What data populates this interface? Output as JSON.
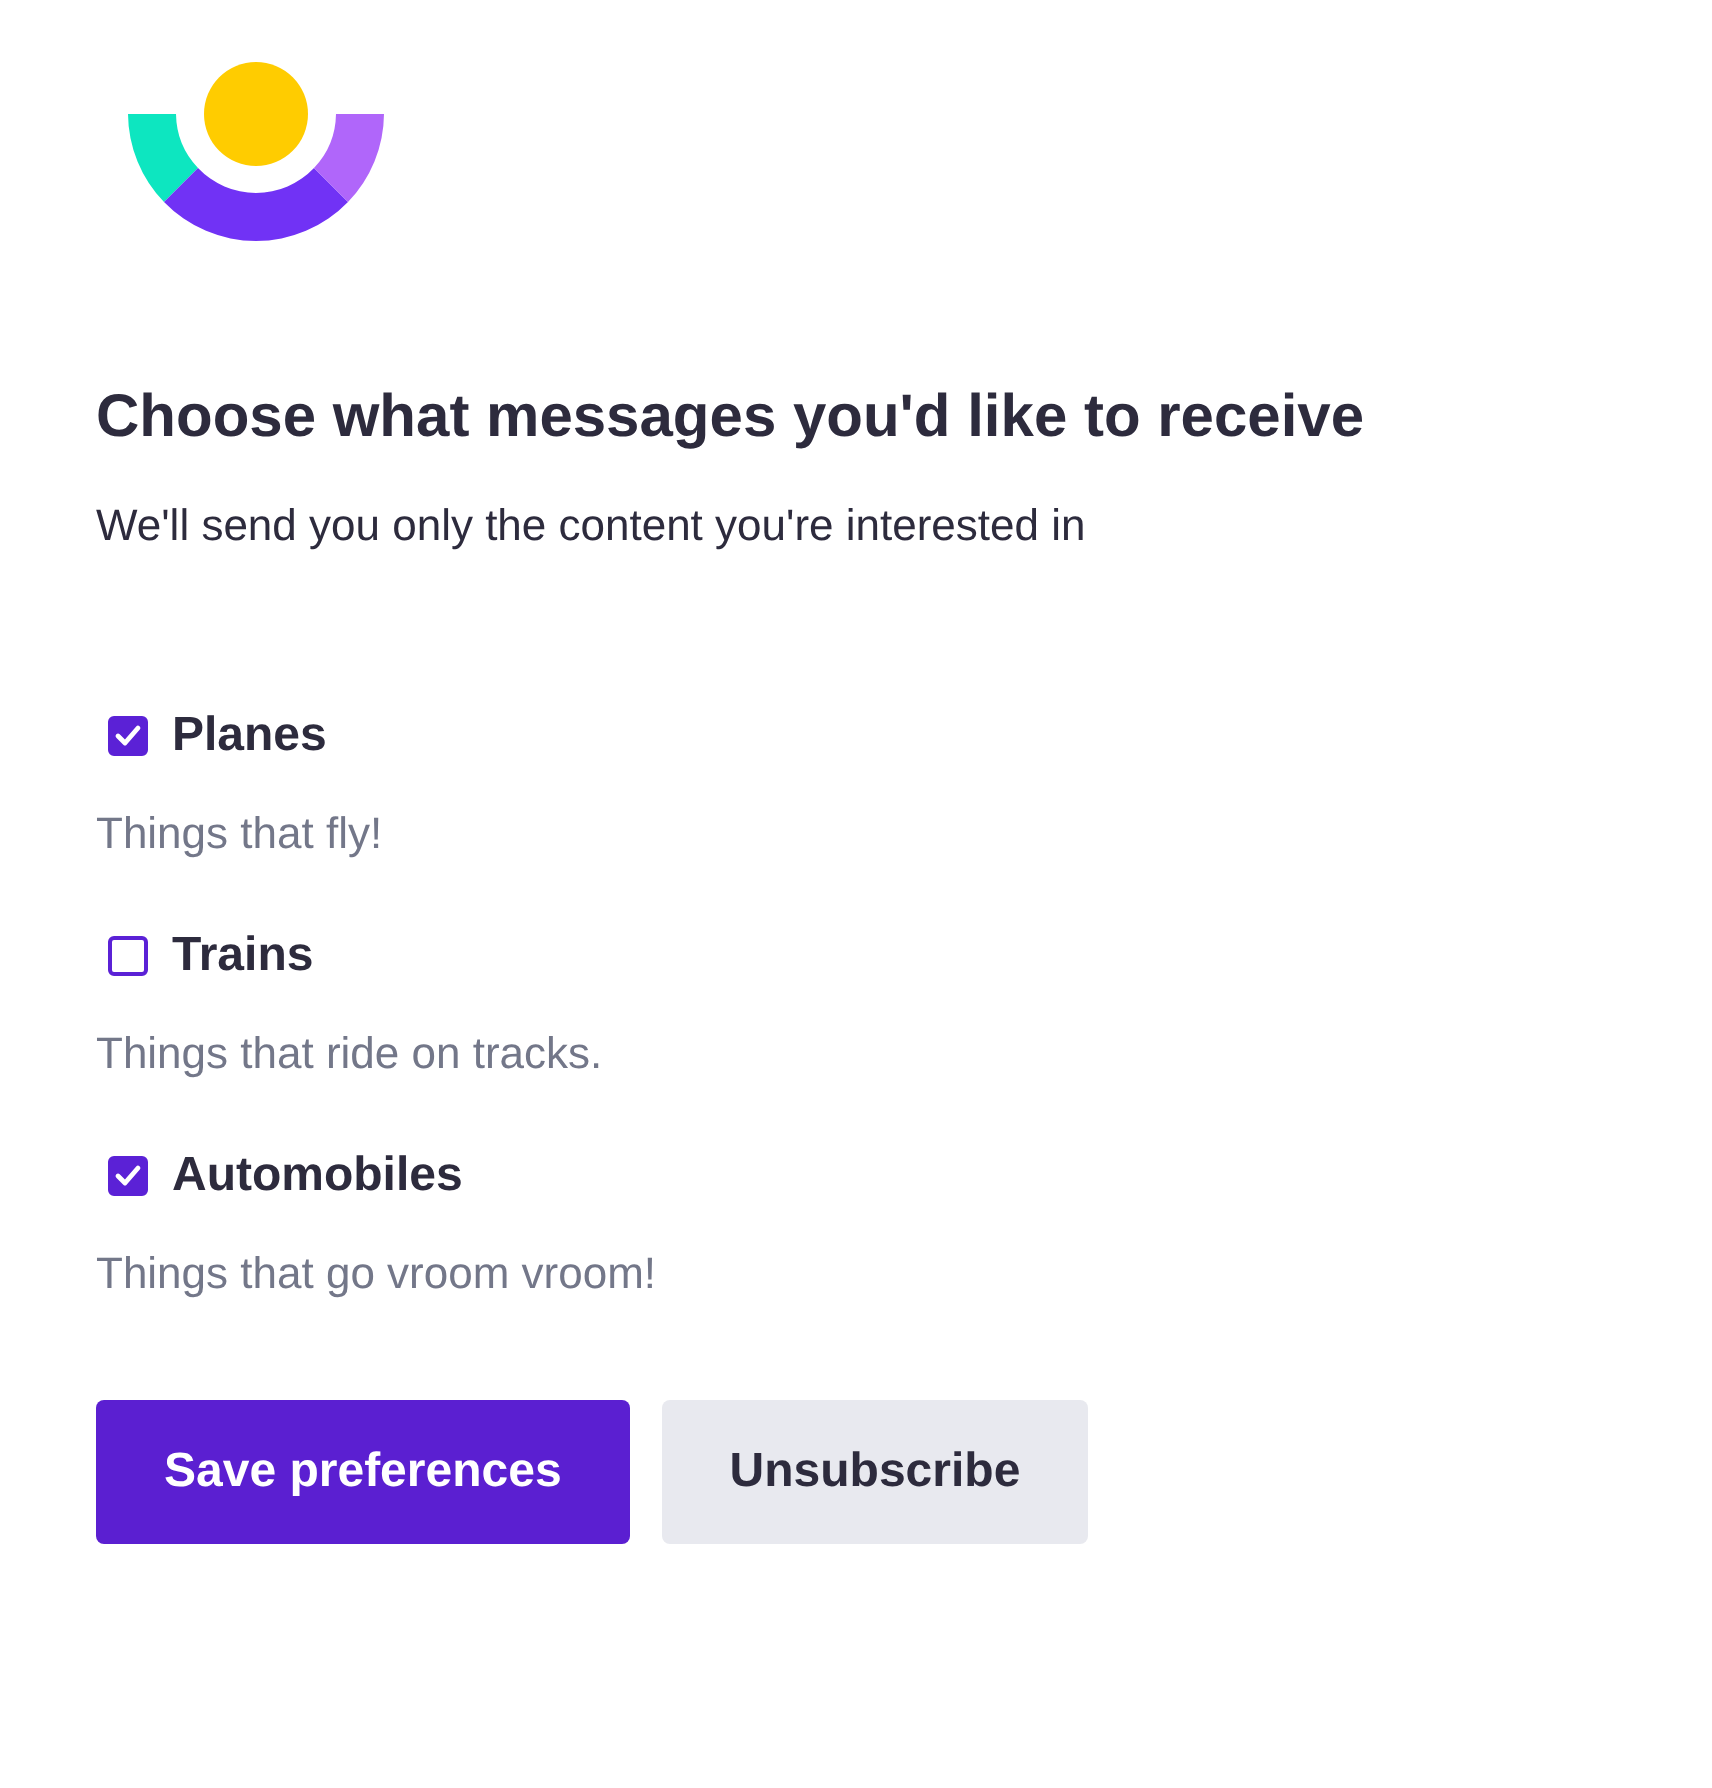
{
  "heading": "Choose what messages you'd like to receive",
  "subheading": "We'll send you only the content you're interested in",
  "topics": [
    {
      "label": "Planes",
      "description": "Things that fly!",
      "checked": true
    },
    {
      "label": "Trains",
      "description": "Things that ride on tracks.",
      "checked": false
    },
    {
      "label": "Automobiles",
      "description": "Things that go vroom vroom!",
      "checked": true
    }
  ],
  "buttons": [
    {
      "label": "Save preferences",
      "kind": "primary"
    },
    {
      "label": "Unsubscribe",
      "kind": "secondary"
    }
  ]
}
